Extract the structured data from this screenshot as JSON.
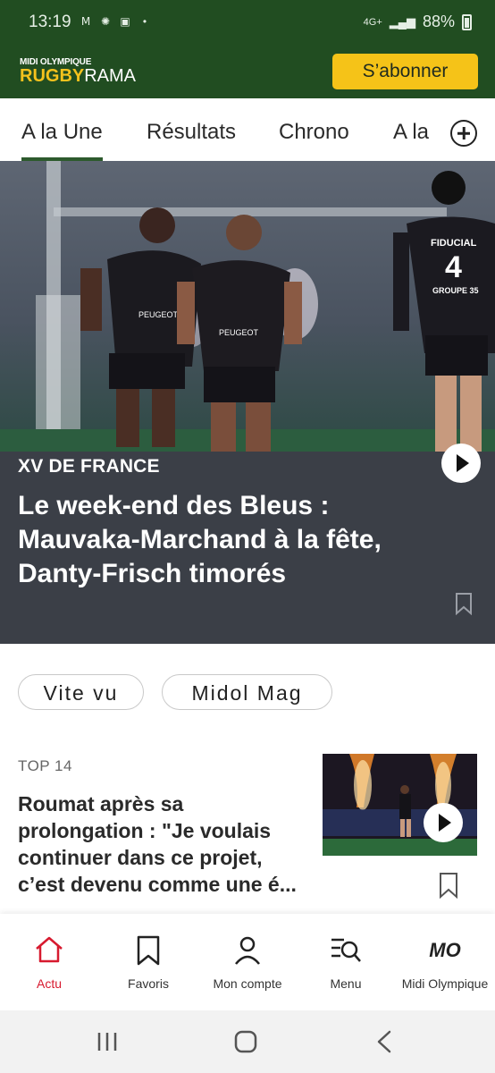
{
  "status_bar": {
    "time": "13:19",
    "network": "4G+",
    "battery": "88%",
    "notification_icons": [
      "m-icon",
      "badge-icon",
      "bmc-icon",
      "dot-icon"
    ]
  },
  "header": {
    "logo_top": "MIDI OLYMPIQUE",
    "logo_main_accent": "RUGBY",
    "logo_main_rest": "RAMA",
    "subscribe_label": "S’abonner",
    "colors": {
      "background": "#214d21",
      "accent": "#f5c318"
    }
  },
  "tabs": {
    "items": [
      {
        "label": "A la Une",
        "active": true
      },
      {
        "label": "Résultats",
        "active": false
      },
      {
        "label": "Chrono",
        "active": false
      },
      {
        "label": "A la",
        "active": false
      }
    ],
    "add_icon": "plus-circle-icon"
  },
  "hero": {
    "kicker": "XV DE FRANCE",
    "headline": "Le week-end des Bleus : Mauvaka-Marchand à la fête, Danty-Frisch timorés",
    "has_video": true,
    "bookmark_icon": "bookmark-icon",
    "photo_texts": {
      "sponsor": "PEUGEOT",
      "sponsor_right": "FIDUCIAL",
      "jersey_number": "4",
      "sponsor_2": "GROUPE 35"
    }
  },
  "chips": [
    {
      "label": "Vite vu"
    },
    {
      "label": "Midol Mag"
    }
  ],
  "article": {
    "kicker": "TOP 14",
    "title": "Roumat après sa prolongation : \"Je voulais continuer dans ce projet, c’est devenu comme une é...",
    "has_video": true,
    "bookmark_icon": "bookmark-icon"
  },
  "bottom_nav": {
    "items": [
      {
        "label": "Actu",
        "icon": "home-icon",
        "active": true
      },
      {
        "label": "Favoris",
        "icon": "bookmark-icon",
        "active": false
      },
      {
        "label": "Mon compte",
        "icon": "user-icon",
        "active": false
      },
      {
        "label": "Menu",
        "icon": "menu-search-icon",
        "active": false
      },
      {
        "label": "Midi Olympique",
        "icon": "mo-logo-icon",
        "active": false
      }
    ],
    "mo_logo_text": "MO",
    "active_color": "#d71a2f"
  },
  "system_nav": [
    "recents-icon",
    "home-circle-icon",
    "back-icon"
  ]
}
